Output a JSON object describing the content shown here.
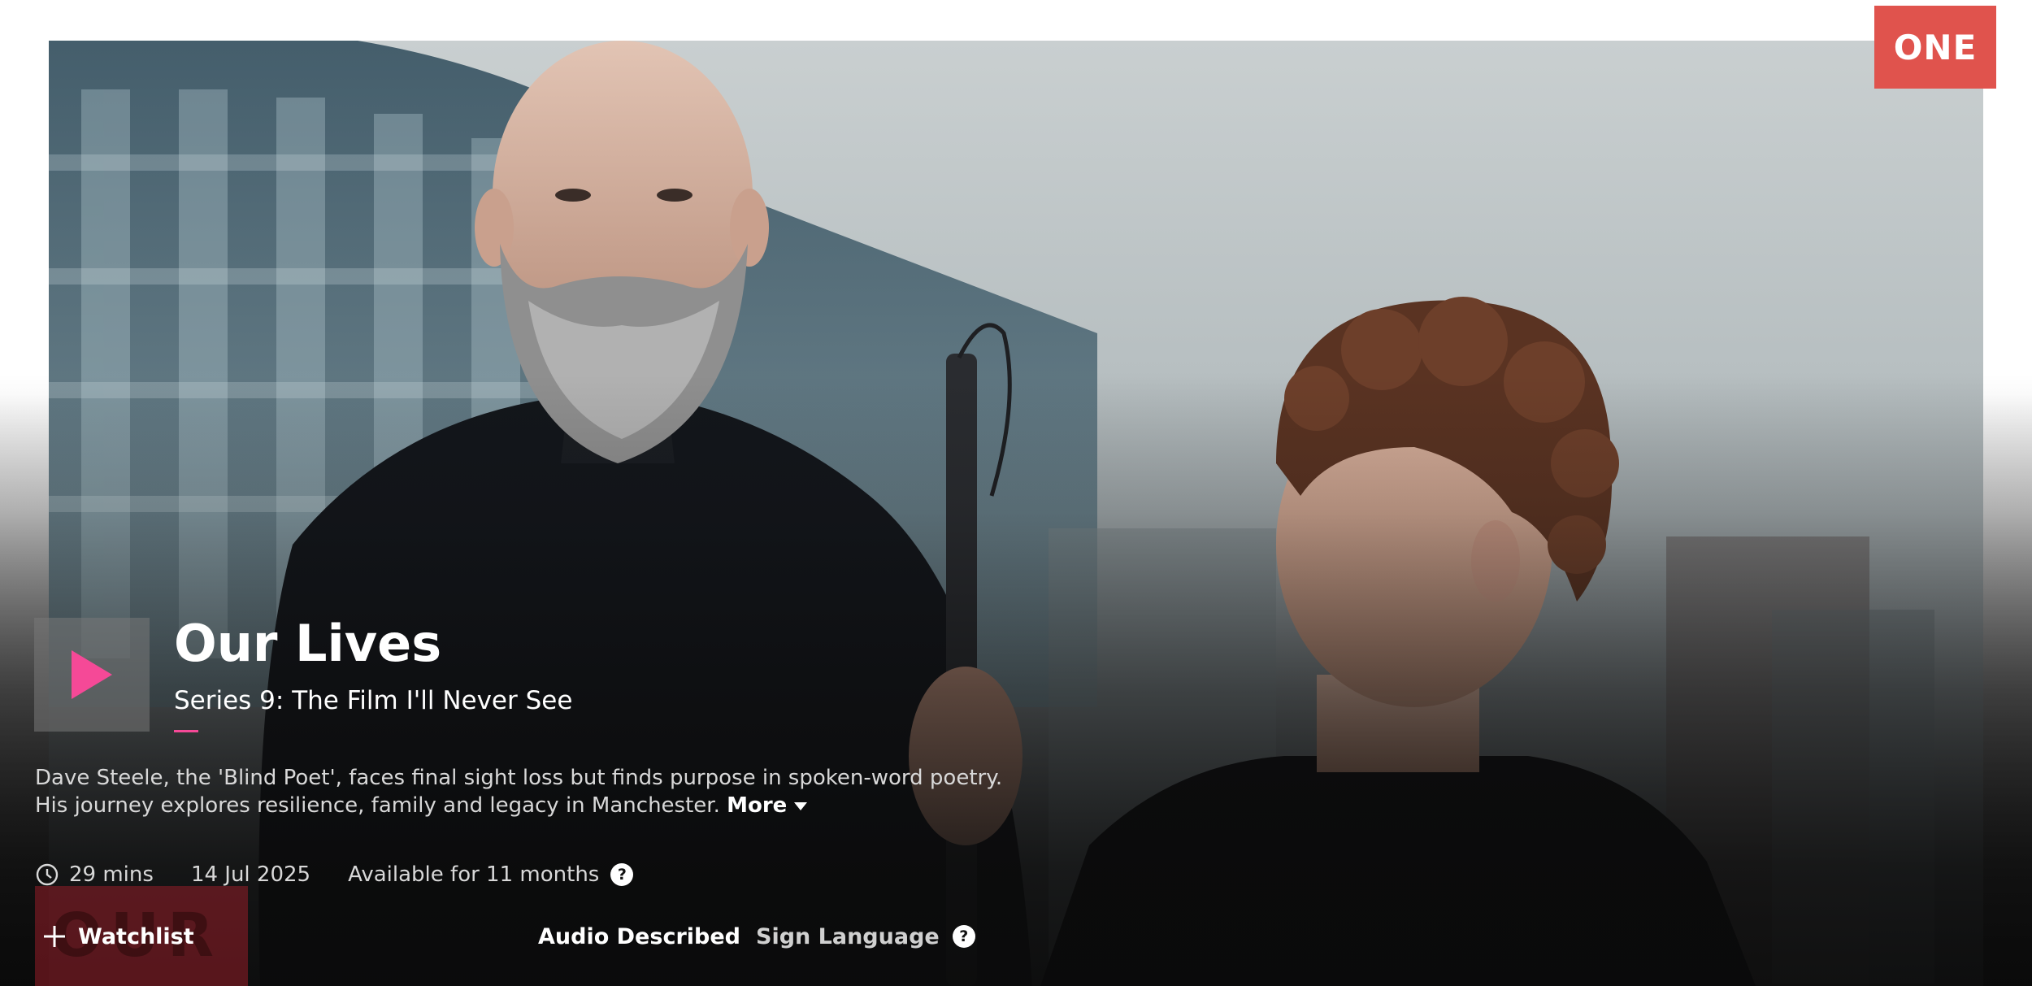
{
  "channel": {
    "label": "ONE",
    "color": "#e0534d"
  },
  "programme": {
    "title": "Our Lives",
    "episode": "Series 9: The Film I'll Never See",
    "description": "Dave Steele, the 'Blind Poet', faces final sight loss but finds purpose in spoken-word poetry. His journey explores resilience, family and legacy in Manchester.",
    "more_label": "More",
    "logo_text": "OUR"
  },
  "meta": {
    "duration": "29 mins",
    "date": "14 Jul 2025",
    "availability": "Available for 11 months",
    "help_glyph": "?"
  },
  "actions": {
    "watchlist_label": "Watchlist",
    "audio_described_label": "Audio Described",
    "sign_language_label": "Sign Language",
    "help_glyph": "?"
  },
  "icons": {
    "play": "play-icon",
    "clock": "clock-icon",
    "plus": "plus-icon",
    "more_caret": "caret-down-icon",
    "help": "help-icon"
  },
  "colors": {
    "accent_pink": "#f54997",
    "text_primary": "#ffffff",
    "text_secondary": "#d8d8d8"
  }
}
